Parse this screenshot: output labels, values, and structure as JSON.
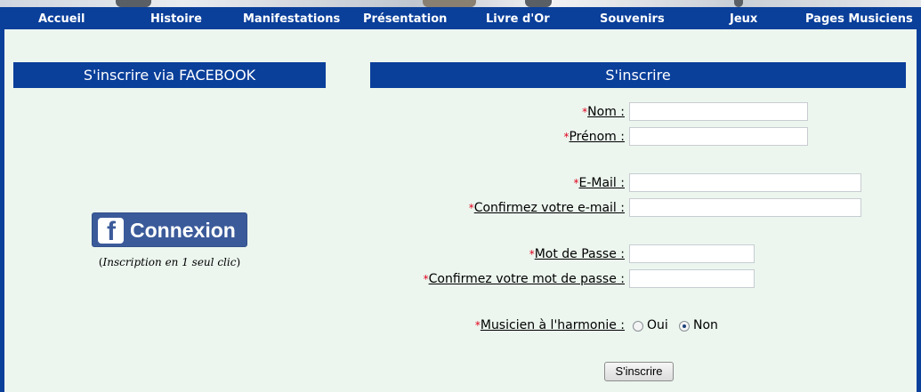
{
  "nav": {
    "items": [
      "Accueil",
      "Histoire",
      "Manifestations",
      "Présentation",
      "Livre d'Or",
      "Souvenirs",
      "Jeux",
      "Pages Musiciens"
    ]
  },
  "left": {
    "title": "S'inscrire via FACEBOOK",
    "fb_button_label": "Connexion",
    "fb_logo_letter": "f",
    "note_open": "(",
    "note_text": "Inscription en 1 seul clic",
    "note_close": ")"
  },
  "form": {
    "title": "S'inscrire",
    "required_marker": "*",
    "nom_label": "Nom :",
    "nom_value": "",
    "prenom_label": "Prénom :",
    "prenom_value": "",
    "email_label": "E-Mail :",
    "email_value": "",
    "email_confirm_label": "Confirmez votre e-mail :",
    "email_confirm_value": "",
    "password_label": "Mot de Passe :",
    "password_value": "",
    "password_confirm_label": "Confirmez votre mot de passe :",
    "password_confirm_value": "",
    "musicien_label": "Musicien à l'harmonie :",
    "musicien_options": [
      "Oui",
      "Non"
    ],
    "musicien_selected": "Non",
    "submit_label": "S'inscrire"
  },
  "colors": {
    "nav_bg": "#0a3f9a",
    "content_bg": "#ecf6ef",
    "facebook_blue": "#3b5a9a",
    "required_star": "#e0001b"
  },
  "icons": {
    "fb": "facebook-icon",
    "radio": "radio-button"
  }
}
